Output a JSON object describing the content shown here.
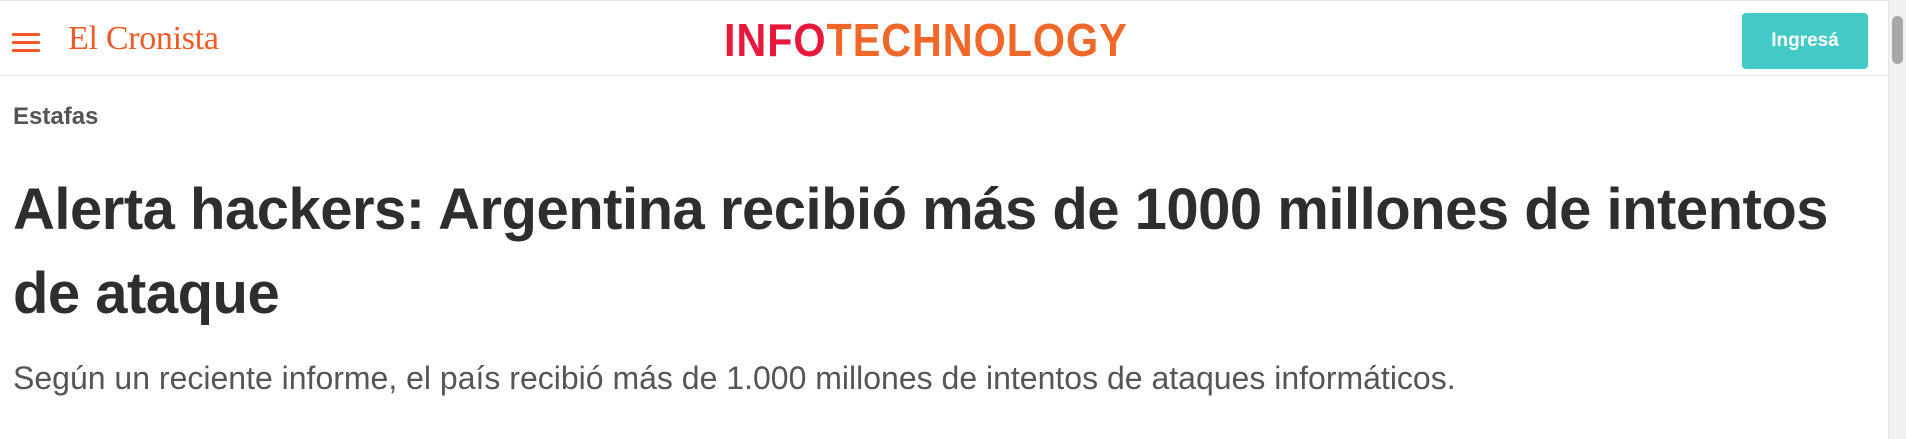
{
  "header": {
    "menu_icon": "hamburger-menu-icon",
    "brand": "El Cronista",
    "logo": {
      "part_a": "INFO",
      "part_b": "TECHNOLOGY"
    },
    "login_label": "Ingresá"
  },
  "article": {
    "section": "Estafas",
    "title": "Alerta hackers: Argentina recibió más de 1000 millones de intentos de ataque",
    "summary": "Según un reciente informe, el país recibió más de 1.000 millones de intentos de ataques informáticos."
  },
  "colors": {
    "brand_orange": "#f05a24",
    "logo_red": "#e8173c",
    "logo_orange": "#f0672a",
    "login_teal": "#43c9c6",
    "headline_text": "#2e2e2e",
    "body_text": "#555555"
  }
}
